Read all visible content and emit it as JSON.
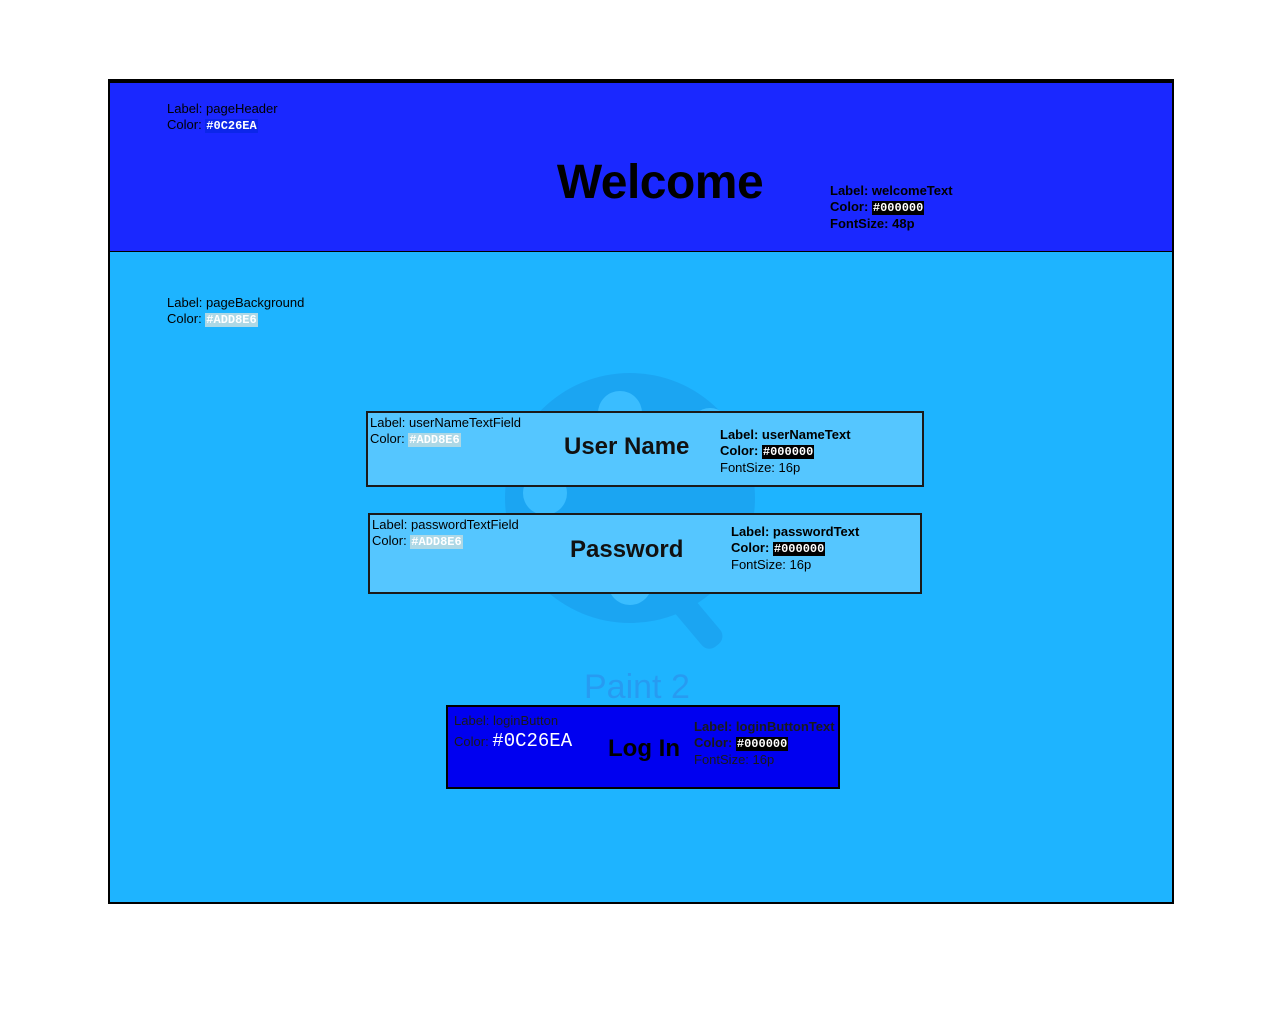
{
  "header": {
    "label_line": "Label: pageHeader",
    "color_prefix": "Color: ",
    "color": "#0C26EA"
  },
  "welcome": {
    "text": "Welcome",
    "label_line": "Label: welcomeText",
    "color_prefix": "Color: ",
    "color": "#000000",
    "font_line": "FontSize: 48p"
  },
  "background": {
    "label_line": "Label: pageBackground",
    "color_prefix": "Color: ",
    "color": "#ADD8E6"
  },
  "user_name_field": {
    "label_line": "Label: userNameTextField",
    "color_prefix": "Color: ",
    "color": "#ADD8E6",
    "text": "User Name",
    "text_label_line": "Label: userNameText",
    "text_color_prefix": "Color: ",
    "text_color": "#000000",
    "font_line": "FontSize: 16p"
  },
  "password_field": {
    "label_line": "Label: passwordTextField",
    "color_prefix": "Color: ",
    "color": "#ADD8E6",
    "text": "Password",
    "text_label_line": "Label: passwordText",
    "text_color_prefix": "Color: ",
    "text_color": "#000000",
    "font_line": "FontSize: 16p"
  },
  "login_button": {
    "label_line": "Label: loginButton",
    "color_prefix": "Color: ",
    "color": "#0C26EA",
    "text": "Log In",
    "text_label_line": "Label: loginButtonText",
    "text_color_prefix": "Color: ",
    "text_color": "#000000",
    "font_line": "FontSize: 16p"
  },
  "watermark": {
    "text": "Paint 2",
    "icon": "paint-palette-icon"
  }
}
